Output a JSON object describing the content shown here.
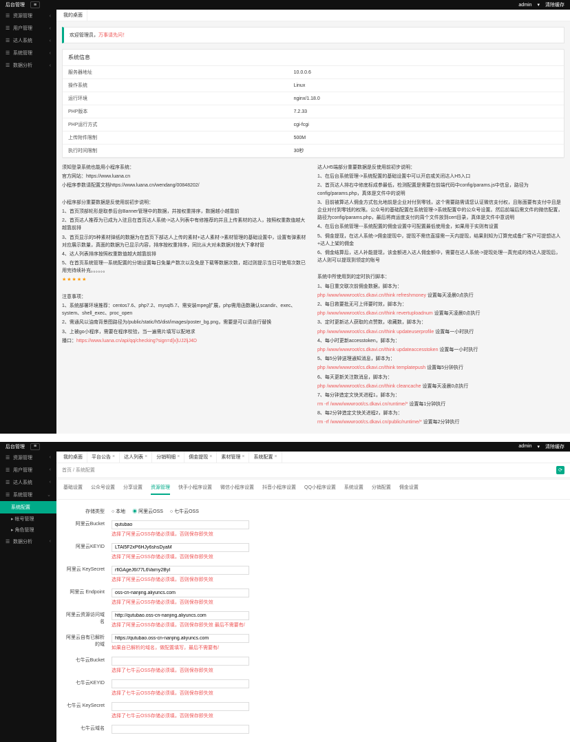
{
  "brand": "后台管理",
  "header": {
    "user": "admin",
    "clear": "清除缓存"
  },
  "sidebar1": {
    "items": [
      "资源管理",
      "用户管理",
      "达人系统",
      "系统管理",
      "数据分析"
    ]
  },
  "tab1": "我的桌面",
  "alert": {
    "t1": "欢迎管理员，",
    "t2": "万事请先问！"
  },
  "sysinfo": {
    "title": "系统信息",
    "rows": [
      [
        "服务器地址",
        "10.0.0.6"
      ],
      [
        "操作系统",
        "Linux"
      ],
      [
        "运行环境",
        "nginx/1.18.0"
      ],
      [
        "PHP版本",
        "7.2.33"
      ],
      [
        "PHP运行方式",
        "cgi-fcgi"
      ],
      [
        "上传附件限制",
        "500M"
      ],
      [
        "执行时间限制",
        "30秒"
      ]
    ]
  },
  "left_notes": {
    "p1": "须知登录系统也能用小程序系统：",
    "p2_label": "官方网站：",
    "p2_url": "https://www.luana.cn",
    "p3": "小程序参数请配置文档https://www.luana.cn/wendang/00848202/",
    "hd": "小程序部分重要数据是反使用前初步说明：",
    "l1": "1、首页顶部轮形是取参后台Banner管理中的数据，并按权重排序，数据越小越靠前",
    "l2": "2、首页达人推荐为已成为入驻且在首页达人系统->达人列表中有修推荐的并且上传素材的达人，按照权重数值越大越靠前排",
    "l3": "3、首页显示的5种素材弹纸的数据为在首页下部达人上传的素材+达人素材->素材管理的基础设置中，设置有弹素材对应展示数量，真面的数据为已显示内容，排序按权重排序，同比从大对未数据对按大下拿材管",
    "l4": "4、达人列表排序按照权重数值越大越靠前排",
    "l5": "5、在首页系统管理---系统配置的分销设置每日免量产数次以及免是下载等数据次数，超过则提示当日可使用次数已用完待续补充。。。。。。",
    "stars": "★★★★★",
    "hd2": "注意事项：",
    "e1": "1、系统部署环境推荐：centos7.6、php7.2、mysql5.7、需安装mpeg扩展，php需用函数确认scandir、exec、system、shell_exec、proc_open",
    "e2": "2、需通风以油南背景图路径为/public/static/h5/dist/images/poster_bg.png，需要是可以请自行替换",
    "e3": "3、上被go小程序，需要在程序校验，当一遍需片填写以配地求",
    "e4_label": "播口：",
    "e4_url": "https://www.luana.cn/api/qq/checking?sign=d[x]UJ2ljJ4D"
  },
  "right_notes": {
    "hd": "达人H5端部分重要数据是反使用前初步说明：",
    "l1": "1、在后台系统管理->系统配置的基础设置中可以开启或关闭达人H5入口",
    "l2": "2、首页达人排右中修底标成参最低，检测配置是需要在前端代码中config/params.js中信息，路径为config/params.php，真体是文件中的说明",
    "l3": "3、目前被算达人佣金方式包允地前是企业对付到零钱，这个需要路需请您认证微信支付权，且账面要有支付中且是企业对付到零钱的权限。公众号的基础配置在系统管理->系统配置中的公众号设置。然后前端后需文件的微信配置，路径为config/params.php，最后将商运度支付的周个文件放到cert目录，真体是文件中意说明",
    "l4": "4、在后台系统管理---系统配置的佣金设置中可配置最低使用金，如果用于实则有设置",
    "l5": "5、佣金提现，在达人系统->佣金提现中，提现不需信直接需一天内提现，结果则知为订算完成备广客户可提想达人+达人上架的佣金",
    "l6": "6、佣金结算后，达人补能提现，该金额进入达人佣金额中，需要在达人系统->提现处理---真完成的待达人提现后，达人则可以提现到领定的账号",
    "hd2": "系统中所使用到的定时执行脚本：",
    "s1_label": "1、每日重交联次前佣金数据，脚本为：",
    "s1_url": "php /www/wwwroot/cs.dkavi.cn/think refreshmoney",
    "s1_note": "设置每天凌晨0点执行",
    "s2_label": "2、每日救要批无可上师要时效，脚本为：",
    "s2_url": "php /www/wwwroot/cs.dkavi.cn/think revertuploadnum",
    "s2_note": "设置每天凌晨0点执行",
    "s3_label": "3、定时更新达人获取的点赞数，收藏数，脚本为：",
    "s3_url": "php /www/wwwroot/cs.dkavi.cn/think updateuserprofile",
    "s3_note": "设置每一小时执行",
    "s4_label": "4、每小时更新accesstoken，脚本为：",
    "s4_url": "php /www/wwwroot/cs.dkavi.cn/think updateaccesstoken",
    "s4_note": "设置每一小时执行",
    "s5_label": "5、每5分钟送理通知消息，脚本为：",
    "s5_url": "php /www/wwwroot/cs.dkavi.cn/think templatepush",
    "s5_note": "设置每5分钟执行",
    "s6_label": "6、每天更新关注数消息，脚本为：",
    "s6_url": "php /www/wwwroot/cs.dkavi.cn/think cleancache",
    "s6_note": "设置每天凌晨0点执行",
    "s7_label": "7、每分钟造定文快关进程1，脚本为：",
    "s7_url": "rm -rf /www/wwwroot/cs.dkavi.cn/runtime/*",
    "s7_note": "设置每1分钟执行",
    "s8_label": "8、每2分钟造定文快关进程2，脚本为：",
    "s8_url": "rm -rf /www/wwwroot/cs.dkavi.cn/public/runtime/*",
    "s8_note": "设置每2分钟执行"
  },
  "tabs2": [
    "我的桌面",
    "平台公告",
    "达人列表",
    "分销明细",
    "佣金提现",
    "素材管理",
    "系统配置"
  ],
  "bc2": "首页 / 系统配置",
  "inner_tabs": [
    "基础设置",
    "公众号设置",
    "分享设置",
    "资源管理",
    "快手小程序设置",
    "微信小程序设置",
    "抖音小程序设置",
    "QQ小程序设置",
    "系统设置",
    "分销配置",
    "佣金设置"
  ],
  "inner_active": 3,
  "form": {
    "storage_label": "存储类型",
    "storage_opts": [
      "本地",
      "阿里云OSS",
      "七牛云OSS"
    ],
    "storage_sel": 1,
    "rows": [
      {
        "label": "阿里云Bucket",
        "val": "qutubao",
        "hint": "选择了阿里云OSS存储必须填，否则保存即失效"
      },
      {
        "label": "阿里云KEYID",
        "val": "LTAl5F2xP6HJy6shsDyaM",
        "hint": "选择了阿里云OSS存储必须填，否则保存即失效"
      },
      {
        "label": "阿里云 KeySecret",
        "val": "rflGAgeJ6I77L6Varny2Byl",
        "hint": "选择了阿里云OSS存储必须填，否则保存即失效"
      },
      {
        "label": "阿里云 Endpoint",
        "val": "oss-cn-nanjing.aliyuncs.com",
        "hint": "选择了阿里云OSS存储必须填，否则保存即失效"
      },
      {
        "label": "阿里云资源访问域名",
        "val": "http://qutubao.oss-cn-nanjing.aliyuncs.com",
        "hint": "选择了阿里云OSS存储必须填，否则保存即失效 最后不需要有/"
      },
      {
        "label": "阿里云自有已解析的域",
        "val": "https://qutubao.oss-cn-nanjing.aliyuncs.com",
        "hint": "如果自已解析的域名，做配置填写，最后不需要有/"
      },
      {
        "label": "七牛云Bucket",
        "val": "",
        "hint": "选择了七牛云OSS存储必须填，否则保存即失效"
      },
      {
        "label": "七牛云KEYID",
        "val": "",
        "hint": "选择了七牛云OSS存储必须填，否则保存即失效"
      },
      {
        "label": "七牛云 KeySecret",
        "val": "",
        "hint": "选择了七牛云OSS存储必须填，否则保存即失效"
      },
      {
        "label": "七牛云域名",
        "val": "",
        "hint": ""
      }
    ]
  }
}
